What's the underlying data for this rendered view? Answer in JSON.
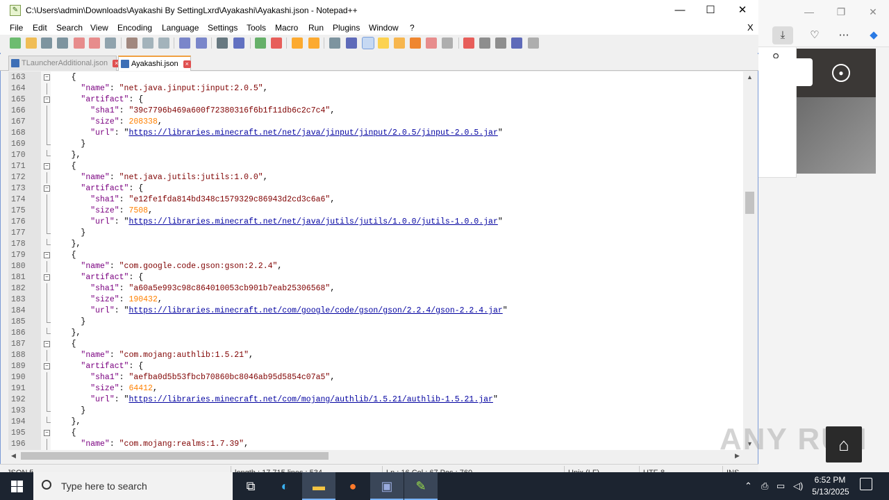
{
  "window": {
    "title": "C:\\Users\\admin\\Downloads\\Ayakashi By SettingLxrd\\Ayakashi\\Ayakashi.json - Notepad++",
    "minimize": "—",
    "maximize": "☐",
    "close": "✕"
  },
  "menu": {
    "items": [
      "File",
      "Edit",
      "Search",
      "View",
      "Encoding",
      "Language",
      "Settings",
      "Tools",
      "Macro",
      "Run",
      "Plugins",
      "Window",
      "?"
    ],
    "close_doc": "X"
  },
  "tabs": [
    {
      "label": "TLauncherAdditional.json",
      "active": false
    },
    {
      "label": "Ayakashi.json",
      "active": true
    }
  ],
  "editor": {
    "lines": [
      {
        "n": "163",
        "fold": "box",
        "text": "    {"
      },
      {
        "n": "164",
        "fold": "line",
        "key": "\"name\"",
        "val": "\"net.java.jinput:jinput:2.0.5\"",
        "vt": "s",
        "tail": ",",
        "indent": "      "
      },
      {
        "n": "165",
        "fold": "box",
        "key": "\"artifact\"",
        "val": "{",
        "vt": "p",
        "tail": "",
        "indent": "      "
      },
      {
        "n": "166",
        "fold": "line",
        "key": "\"sha1\"",
        "val": "\"39c7796b469a600f72380316f6b1f11db6c2c7c4\"",
        "vt": "s",
        "tail": ",",
        "indent": "        "
      },
      {
        "n": "167",
        "fold": "line",
        "key": "\"size\"",
        "val": "208338",
        "vt": "n",
        "tail": ",",
        "indent": "        "
      },
      {
        "n": "168",
        "fold": "line",
        "key": "\"url\"",
        "val": "https://libraries.minecraft.net/net/java/jinput/jinput/2.0.5/jinput-2.0.5.jar",
        "vt": "u",
        "tail": "",
        "indent": "        "
      },
      {
        "n": "169",
        "fold": "end",
        "text": "      }"
      },
      {
        "n": "170",
        "fold": "end",
        "text": "    },"
      },
      {
        "n": "171",
        "fold": "box",
        "text": "    {"
      },
      {
        "n": "172",
        "fold": "line",
        "key": "\"name\"",
        "val": "\"net.java.jutils:jutils:1.0.0\"",
        "vt": "s",
        "tail": ",",
        "indent": "      "
      },
      {
        "n": "173",
        "fold": "box",
        "key": "\"artifact\"",
        "val": "{",
        "vt": "p",
        "tail": "",
        "indent": "      "
      },
      {
        "n": "174",
        "fold": "line",
        "key": "\"sha1\"",
        "val": "\"e12fe1fda814bd348c1579329c86943d2cd3c6a6\"",
        "vt": "s",
        "tail": ",",
        "indent": "        "
      },
      {
        "n": "175",
        "fold": "line",
        "key": "\"size\"",
        "val": "7508",
        "vt": "n",
        "tail": ",",
        "indent": "        "
      },
      {
        "n": "176",
        "fold": "line",
        "key": "\"url\"",
        "val": "https://libraries.minecraft.net/net/java/jutils/jutils/1.0.0/jutils-1.0.0.jar",
        "vt": "u",
        "tail": "",
        "indent": "        "
      },
      {
        "n": "177",
        "fold": "end",
        "text": "      }"
      },
      {
        "n": "178",
        "fold": "end",
        "text": "    },"
      },
      {
        "n": "179",
        "fold": "box",
        "text": "    {"
      },
      {
        "n": "180",
        "fold": "line",
        "key": "\"name\"",
        "val": "\"com.google.code.gson:gson:2.2.4\"",
        "vt": "s",
        "tail": ",",
        "indent": "      "
      },
      {
        "n": "181",
        "fold": "box",
        "key": "\"artifact\"",
        "val": "{",
        "vt": "p",
        "tail": "",
        "indent": "      "
      },
      {
        "n": "182",
        "fold": "line",
        "key": "\"sha1\"",
        "val": "\"a60a5e993c98c864010053cb901b7eab25306568\"",
        "vt": "s",
        "tail": ",",
        "indent": "        "
      },
      {
        "n": "183",
        "fold": "line",
        "key": "\"size\"",
        "val": "190432",
        "vt": "n",
        "tail": ",",
        "indent": "        "
      },
      {
        "n": "184",
        "fold": "line",
        "key": "\"url\"",
        "val": "https://libraries.minecraft.net/com/google/code/gson/gson/2.2.4/gson-2.2.4.jar",
        "vt": "u",
        "tail": "",
        "indent": "        "
      },
      {
        "n": "185",
        "fold": "end",
        "text": "      }"
      },
      {
        "n": "186",
        "fold": "end",
        "text": "    },"
      },
      {
        "n": "187",
        "fold": "box",
        "text": "    {"
      },
      {
        "n": "188",
        "fold": "line",
        "key": "\"name\"",
        "val": "\"com.mojang:authlib:1.5.21\"",
        "vt": "s",
        "tail": ",",
        "indent": "      "
      },
      {
        "n": "189",
        "fold": "box",
        "key": "\"artifact\"",
        "val": "{",
        "vt": "p",
        "tail": "",
        "indent": "      "
      },
      {
        "n": "190",
        "fold": "line",
        "key": "\"sha1\"",
        "val": "\"aefba0d5b53fbcb70860bc8046ab95d5854c07a5\"",
        "vt": "s",
        "tail": ",",
        "indent": "        "
      },
      {
        "n": "191",
        "fold": "line",
        "key": "\"size\"",
        "val": "64412",
        "vt": "n",
        "tail": ",",
        "indent": "        "
      },
      {
        "n": "192",
        "fold": "line",
        "key": "\"url\"",
        "val": "https://libraries.minecraft.net/com/mojang/authlib/1.5.21/authlib-1.5.21.jar",
        "vt": "u",
        "tail": "",
        "indent": "        "
      },
      {
        "n": "193",
        "fold": "end",
        "text": "      }"
      },
      {
        "n": "194",
        "fold": "end",
        "text": "    },"
      },
      {
        "n": "195",
        "fold": "box",
        "text": "    {"
      },
      {
        "n": "196",
        "fold": "line",
        "key": "\"name\"",
        "val": "\"com.mojang:realms:1.7.39\"",
        "vt": "s",
        "tail": ",",
        "indent": "      "
      }
    ]
  },
  "statusbar": {
    "type": "JSON fi",
    "length": "length : 17,715    lines : 534",
    "position": "Ln : 16    Col : 67    Pos : 760",
    "eol": "Unix (LF)",
    "encoding": "UTF-8",
    "mode": "INS"
  },
  "watermark": {
    "text": "ANY RUN"
  },
  "taskbar": {
    "search_placeholder": "Type here to search",
    "time": "6:52 PM",
    "date": "5/13/2025"
  },
  "colors": {
    "title_accent": "#7a9ad6",
    "tab_active_accent": "#f0a040",
    "taskbar_bg": "#1c2430"
  }
}
